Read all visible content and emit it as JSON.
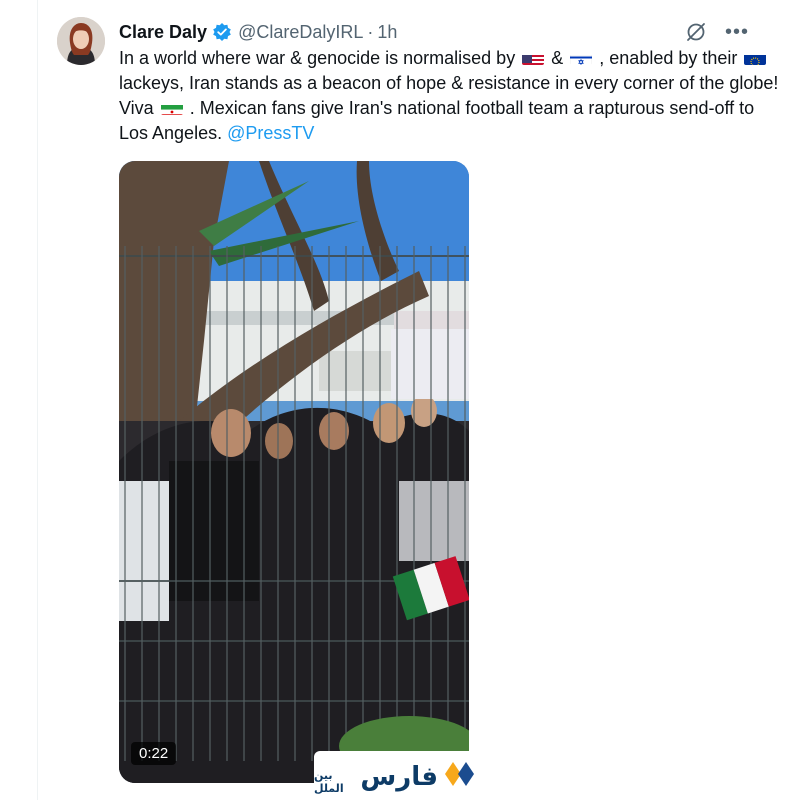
{
  "tweet": {
    "author_name": "Clare Daly",
    "handle": "@ClareDalyIRL",
    "separator": "·",
    "time": "1h",
    "text_parts": {
      "p1": "In a world where war & genocide is normalised by",
      "amp": "&",
      "p2": ",  enabled by their",
      "p3": "lackeys, Iran stands as a beacon of hope & resistance in every corner of the globe! Viva",
      "p4": ". Mexican fans give Iran's national football team a rapturous send-off to Los Angeles.",
      "mention": "@PressTV"
    },
    "flags": [
      "flag-us-icon",
      "flag-israel-icon",
      "flag-eu-icon",
      "flag-iran-icon"
    ],
    "media": {
      "duration": "0:22",
      "watermark_main": "فارس",
      "watermark_sub": "بين الملل"
    }
  },
  "icons": {
    "verified": "verified-badge-icon",
    "grok": "grok-icon",
    "more": "more-icon"
  },
  "colors": {
    "accent": "#1d9bf0",
    "text": "#0f1419",
    "secondary": "#536471"
  }
}
